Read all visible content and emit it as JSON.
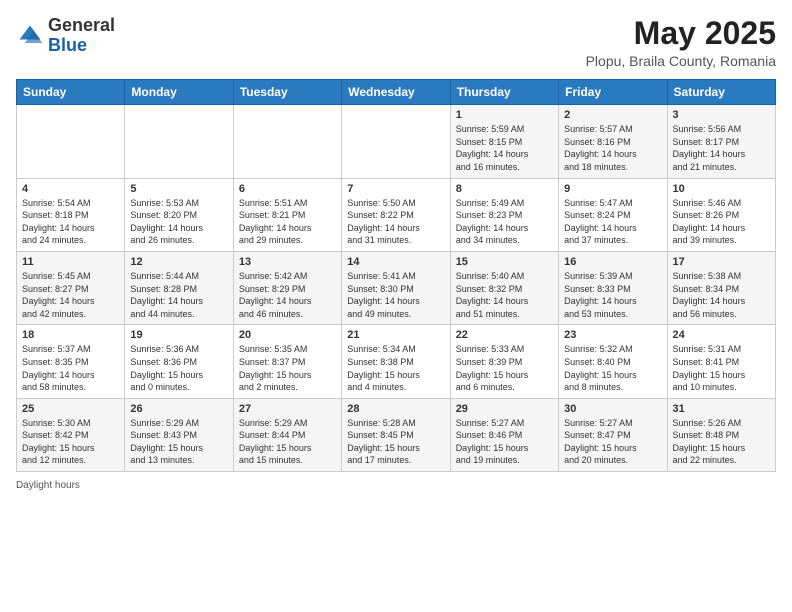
{
  "header": {
    "logo_general": "General",
    "logo_blue": "Blue",
    "month_title": "May 2025",
    "subtitle": "Plopu, Braila County, Romania"
  },
  "weekdays": [
    "Sunday",
    "Monday",
    "Tuesday",
    "Wednesday",
    "Thursday",
    "Friday",
    "Saturday"
  ],
  "footer": {
    "daylight_hours": "Daylight hours"
  },
  "weeks": [
    [
      {
        "day": "",
        "info": ""
      },
      {
        "day": "",
        "info": ""
      },
      {
        "day": "",
        "info": ""
      },
      {
        "day": "",
        "info": ""
      },
      {
        "day": "1",
        "info": "Sunrise: 5:59 AM\nSunset: 8:15 PM\nDaylight: 14 hours\nand 16 minutes."
      },
      {
        "day": "2",
        "info": "Sunrise: 5:57 AM\nSunset: 8:16 PM\nDaylight: 14 hours\nand 18 minutes."
      },
      {
        "day": "3",
        "info": "Sunrise: 5:56 AM\nSunset: 8:17 PM\nDaylight: 14 hours\nand 21 minutes."
      }
    ],
    [
      {
        "day": "4",
        "info": "Sunrise: 5:54 AM\nSunset: 8:18 PM\nDaylight: 14 hours\nand 24 minutes."
      },
      {
        "day": "5",
        "info": "Sunrise: 5:53 AM\nSunset: 8:20 PM\nDaylight: 14 hours\nand 26 minutes."
      },
      {
        "day": "6",
        "info": "Sunrise: 5:51 AM\nSunset: 8:21 PM\nDaylight: 14 hours\nand 29 minutes."
      },
      {
        "day": "7",
        "info": "Sunrise: 5:50 AM\nSunset: 8:22 PM\nDaylight: 14 hours\nand 31 minutes."
      },
      {
        "day": "8",
        "info": "Sunrise: 5:49 AM\nSunset: 8:23 PM\nDaylight: 14 hours\nand 34 minutes."
      },
      {
        "day": "9",
        "info": "Sunrise: 5:47 AM\nSunset: 8:24 PM\nDaylight: 14 hours\nand 37 minutes."
      },
      {
        "day": "10",
        "info": "Sunrise: 5:46 AM\nSunset: 8:26 PM\nDaylight: 14 hours\nand 39 minutes."
      }
    ],
    [
      {
        "day": "11",
        "info": "Sunrise: 5:45 AM\nSunset: 8:27 PM\nDaylight: 14 hours\nand 42 minutes."
      },
      {
        "day": "12",
        "info": "Sunrise: 5:44 AM\nSunset: 8:28 PM\nDaylight: 14 hours\nand 44 minutes."
      },
      {
        "day": "13",
        "info": "Sunrise: 5:42 AM\nSunset: 8:29 PM\nDaylight: 14 hours\nand 46 minutes."
      },
      {
        "day": "14",
        "info": "Sunrise: 5:41 AM\nSunset: 8:30 PM\nDaylight: 14 hours\nand 49 minutes."
      },
      {
        "day": "15",
        "info": "Sunrise: 5:40 AM\nSunset: 8:32 PM\nDaylight: 14 hours\nand 51 minutes."
      },
      {
        "day": "16",
        "info": "Sunrise: 5:39 AM\nSunset: 8:33 PM\nDaylight: 14 hours\nand 53 minutes."
      },
      {
        "day": "17",
        "info": "Sunrise: 5:38 AM\nSunset: 8:34 PM\nDaylight: 14 hours\nand 56 minutes."
      }
    ],
    [
      {
        "day": "18",
        "info": "Sunrise: 5:37 AM\nSunset: 8:35 PM\nDaylight: 14 hours\nand 58 minutes."
      },
      {
        "day": "19",
        "info": "Sunrise: 5:36 AM\nSunset: 8:36 PM\nDaylight: 15 hours\nand 0 minutes."
      },
      {
        "day": "20",
        "info": "Sunrise: 5:35 AM\nSunset: 8:37 PM\nDaylight: 15 hours\nand 2 minutes."
      },
      {
        "day": "21",
        "info": "Sunrise: 5:34 AM\nSunset: 8:38 PM\nDaylight: 15 hours\nand 4 minutes."
      },
      {
        "day": "22",
        "info": "Sunrise: 5:33 AM\nSunset: 8:39 PM\nDaylight: 15 hours\nand 6 minutes."
      },
      {
        "day": "23",
        "info": "Sunrise: 5:32 AM\nSunset: 8:40 PM\nDaylight: 15 hours\nand 8 minutes."
      },
      {
        "day": "24",
        "info": "Sunrise: 5:31 AM\nSunset: 8:41 PM\nDaylight: 15 hours\nand 10 minutes."
      }
    ],
    [
      {
        "day": "25",
        "info": "Sunrise: 5:30 AM\nSunset: 8:42 PM\nDaylight: 15 hours\nand 12 minutes."
      },
      {
        "day": "26",
        "info": "Sunrise: 5:29 AM\nSunset: 8:43 PM\nDaylight: 15 hours\nand 13 minutes."
      },
      {
        "day": "27",
        "info": "Sunrise: 5:29 AM\nSunset: 8:44 PM\nDaylight: 15 hours\nand 15 minutes."
      },
      {
        "day": "28",
        "info": "Sunrise: 5:28 AM\nSunset: 8:45 PM\nDaylight: 15 hours\nand 17 minutes."
      },
      {
        "day": "29",
        "info": "Sunrise: 5:27 AM\nSunset: 8:46 PM\nDaylight: 15 hours\nand 19 minutes."
      },
      {
        "day": "30",
        "info": "Sunrise: 5:27 AM\nSunset: 8:47 PM\nDaylight: 15 hours\nand 20 minutes."
      },
      {
        "day": "31",
        "info": "Sunrise: 5:26 AM\nSunset: 8:48 PM\nDaylight: 15 hours\nand 22 minutes."
      }
    ]
  ]
}
